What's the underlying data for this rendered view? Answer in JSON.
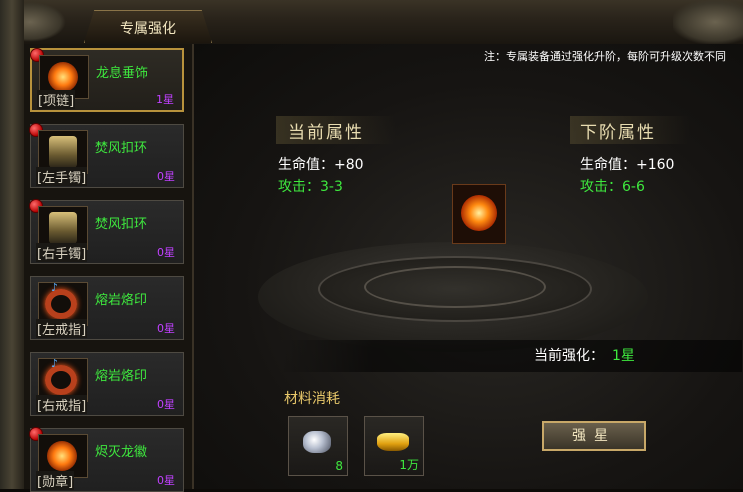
{
  "window": {
    "title": "专属强化"
  },
  "notice": "注：专属装备通过强化升阶，每阶可升级次数不同",
  "slots": [
    {
      "name": "龙息垂饰",
      "slot": "[项链]",
      "star": "1星",
      "icon": "necklace-icon",
      "selected": true
    },
    {
      "name": "焚风扣环",
      "slot": "[左手镯]",
      "star": "0星",
      "icon": "bracelet-icon"
    },
    {
      "name": "焚风扣环",
      "slot": "[右手镯]",
      "star": "0星",
      "icon": "bracelet-icon"
    },
    {
      "name": "熔岩烙印",
      "slot": "[左戒指]",
      "star": "0星",
      "icon": "ring-icon"
    },
    {
      "name": "熔岩烙印",
      "slot": "[右戒指]",
      "star": "0星",
      "icon": "ring-icon"
    },
    {
      "name": "烬灭龙徽",
      "slot": "[勋章]",
      "star": "0星",
      "icon": "medal-icon"
    }
  ],
  "current": {
    "title": "当前属性",
    "hp": "生命值：+80",
    "atk": "攻击：3-3"
  },
  "next": {
    "title": "下阶属性",
    "hp": "生命值：+160",
    "atk": "攻击：6-6"
  },
  "enhance": {
    "label": "当前强化：",
    "value": "1星"
  },
  "materials": {
    "title": "材料消耗",
    "items": [
      {
        "icon": "gem-icon",
        "count": "8"
      },
      {
        "icon": "gold-ingot-icon",
        "count": "1万"
      }
    ]
  },
  "button": {
    "label": "强星"
  },
  "colors": {
    "green": "#3ee83e",
    "purple": "#c040ff",
    "gold": "#b8923c"
  }
}
